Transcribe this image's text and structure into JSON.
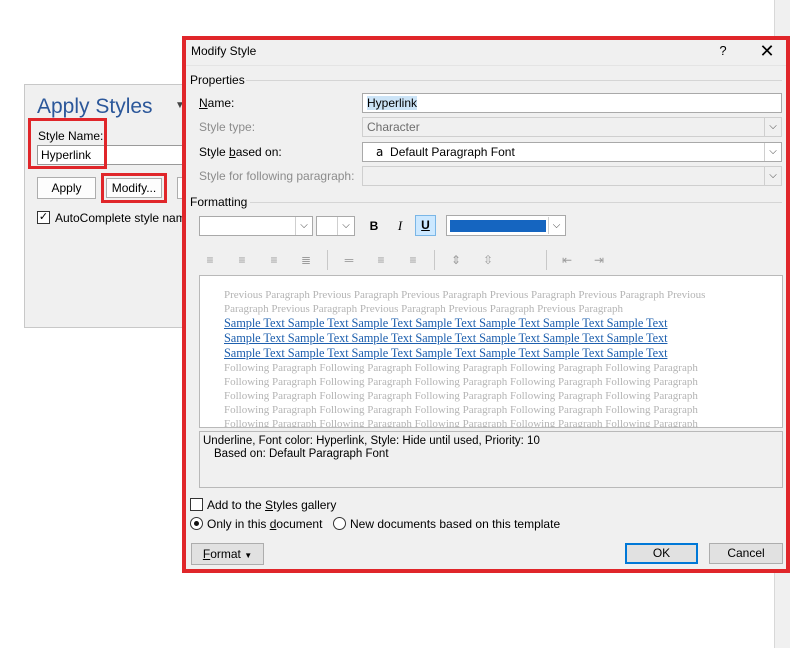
{
  "apply_styles": {
    "title": "Apply Styles",
    "style_name_label": "Style Name:",
    "style_name_value": "Hyperlink",
    "apply_label": "Apply",
    "modify_label": "Modify...",
    "autocomplete_label": "AutoComplete style names",
    "autocomplete_checked": true
  },
  "dialog": {
    "title": "Modify Style",
    "help": "?",
    "close": "✕",
    "properties_label": "Properties",
    "name_label": "Name:",
    "name_value": "Hyperlink",
    "style_type_label": "Style type:",
    "style_type_value": "Character",
    "based_on_label": "Style based on:",
    "based_on_value": "Default Paragraph Font",
    "based_on_icon": "a",
    "following_label": "Style for following paragraph:",
    "following_value": "",
    "formatting_label": "Formatting",
    "font_value": "",
    "size_value": "",
    "bold": "B",
    "italic": "I",
    "underline": "U",
    "font_color": "#1565c0",
    "preview": {
      "previous": [
        "Previous Paragraph Previous Paragraph Previous Paragraph Previous Paragraph Previous Paragraph Previous",
        "Paragraph Previous Paragraph Previous Paragraph Previous Paragraph Previous Paragraph"
      ],
      "sample": [
        "Sample Text Sample Text Sample Text Sample Text Sample Text Sample Text Sample Text",
        "Sample Text Sample Text Sample Text Sample Text Sample Text Sample Text Sample Text",
        "Sample Text Sample Text Sample Text Sample Text Sample Text Sample Text Sample Text"
      ],
      "following": [
        "Following Paragraph Following Paragraph Following Paragraph Following Paragraph Following Paragraph",
        "Following Paragraph Following Paragraph Following Paragraph Following Paragraph Following Paragraph",
        "Following Paragraph Following Paragraph Following Paragraph Following Paragraph Following Paragraph",
        "Following Paragraph Following Paragraph Following Paragraph Following Paragraph Following Paragraph",
        "Following Paragraph Following Paragraph Following Paragraph Following Paragraph Following Paragraph"
      ]
    },
    "description_line1": "Underline, Font color: Hyperlink, Style: Hide until used, Priority: 10",
    "description_line2": "Based on: Default Paragraph Font",
    "add_to_gallery_label": "Add to the Styles gallery",
    "add_to_gallery_checked": false,
    "only_in_document_label": "Only in this document",
    "only_in_document_selected": true,
    "new_documents_label": "New documents based on this template",
    "new_documents_selected": false,
    "format_button": "Format",
    "ok_button": "OK",
    "cancel_button": "Cancel"
  },
  "colors": {
    "highlight_red": "#e0262a",
    "accent_blue": "#0078d7",
    "pane_title_blue": "#2b579a",
    "hyperlink_blue": "#1d5fae"
  }
}
